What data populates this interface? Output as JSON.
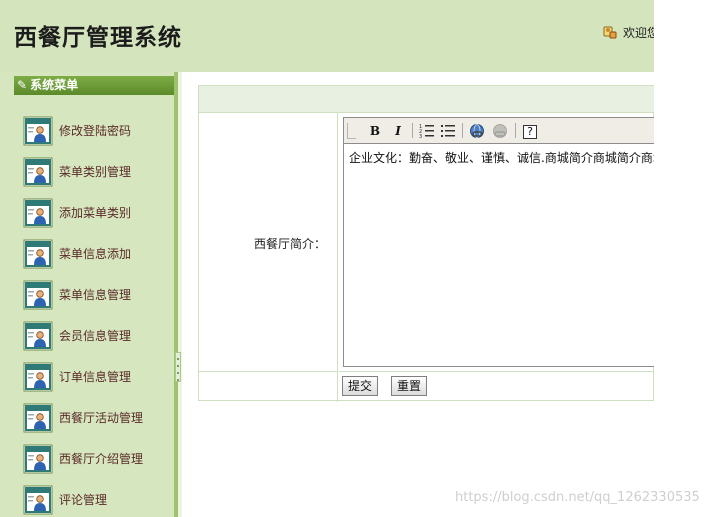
{
  "header": {
    "app_title": "西餐厅管理系统",
    "welcome_text": "欢迎您",
    "welcome_icon": "user-key-icon"
  },
  "sidebar": {
    "title": "系统菜单",
    "title_icon": "pencil-icon",
    "item_icon": "user-card-icon",
    "items": [
      {
        "label": "修改登陆密码"
      },
      {
        "label": "菜单类别管理"
      },
      {
        "label": "添加菜单类别"
      },
      {
        "label": "菜单信息添加"
      },
      {
        "label": "菜单信息管理"
      },
      {
        "label": "会员信息管理"
      },
      {
        "label": "订单信息管理"
      },
      {
        "label": "西餐厅活动管理"
      },
      {
        "label": "西餐厅介绍管理"
      },
      {
        "label": "评论管理"
      }
    ]
  },
  "form": {
    "field_label": "西餐厅简介：",
    "editor": {
      "content": "企业文化：勤奋、敬业、谨慎、诚信.商城简介商城简介商城简介",
      "toolbar": [
        {
          "name": "bold",
          "label": "B"
        },
        {
          "name": "italic",
          "label": "I"
        },
        {
          "name": "ordered-list",
          "label": "ordered-list-icon"
        },
        {
          "name": "unordered-list",
          "label": "unordered-list-icon"
        },
        {
          "name": "link",
          "label": "link-icon"
        },
        {
          "name": "unlink",
          "label": "unlink-icon"
        },
        {
          "name": "help",
          "label": "?"
        }
      ]
    },
    "submit_label": "提交",
    "reset_label": "重置"
  },
  "watermark": "https://blog.csdn.net/qq_1262330535",
  "colors": {
    "header_bg": "#d4e4bd",
    "sidebar_bg": "#d6e7bf",
    "sidebar_title_bg": "#6c9b38",
    "menu_text": "#5a2a2a",
    "form_header_bg": "#e8f0e2"
  }
}
